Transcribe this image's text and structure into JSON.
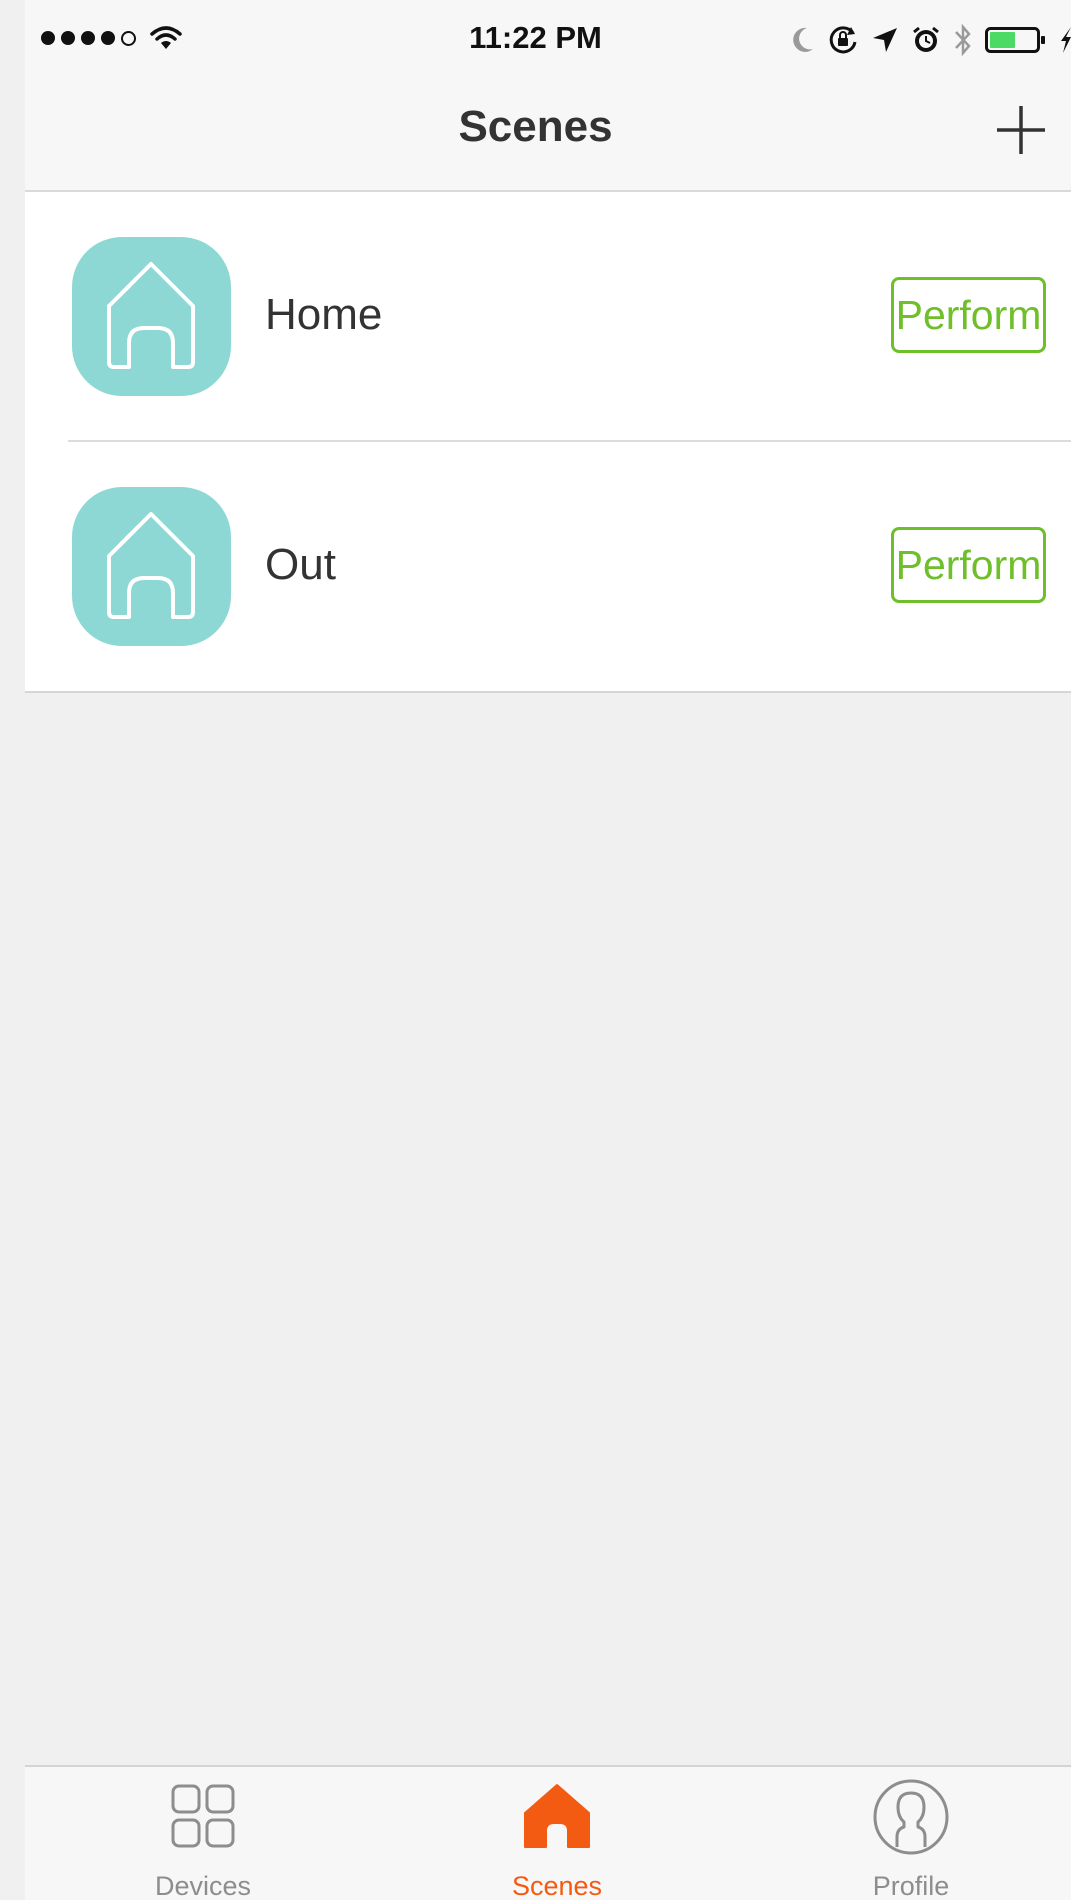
{
  "status_bar": {
    "time": "11:22 PM",
    "signal_bars": 4,
    "signal_total": 5,
    "battery_level": 0.55,
    "battery_color": "#4cd964",
    "icons": [
      "wifi-icon",
      "moon-icon",
      "rotation-lock-icon",
      "location-arrow-icon",
      "alarm-icon",
      "bluetooth-icon",
      "battery-icon",
      "charging-bolt-icon"
    ]
  },
  "nav": {
    "title": "Scenes",
    "add_icon": "plus-icon"
  },
  "scenes": [
    {
      "name": "Home",
      "icon": "house-icon",
      "action_label": "Perform"
    },
    {
      "name": "Out",
      "icon": "house-icon",
      "action_label": "Perform"
    }
  ],
  "colors": {
    "scene_icon_bg": "#8dd8d4",
    "perform_green": "#6ebf29",
    "active_tab": "#f35b13",
    "inactive_tab": "#8d8d8d"
  },
  "tabs": [
    {
      "label": "Devices",
      "icon": "grid-icon",
      "active": false
    },
    {
      "label": "Scenes",
      "icon": "house-icon",
      "active": true
    },
    {
      "label": "Profile",
      "icon": "person-icon",
      "active": false
    }
  ]
}
